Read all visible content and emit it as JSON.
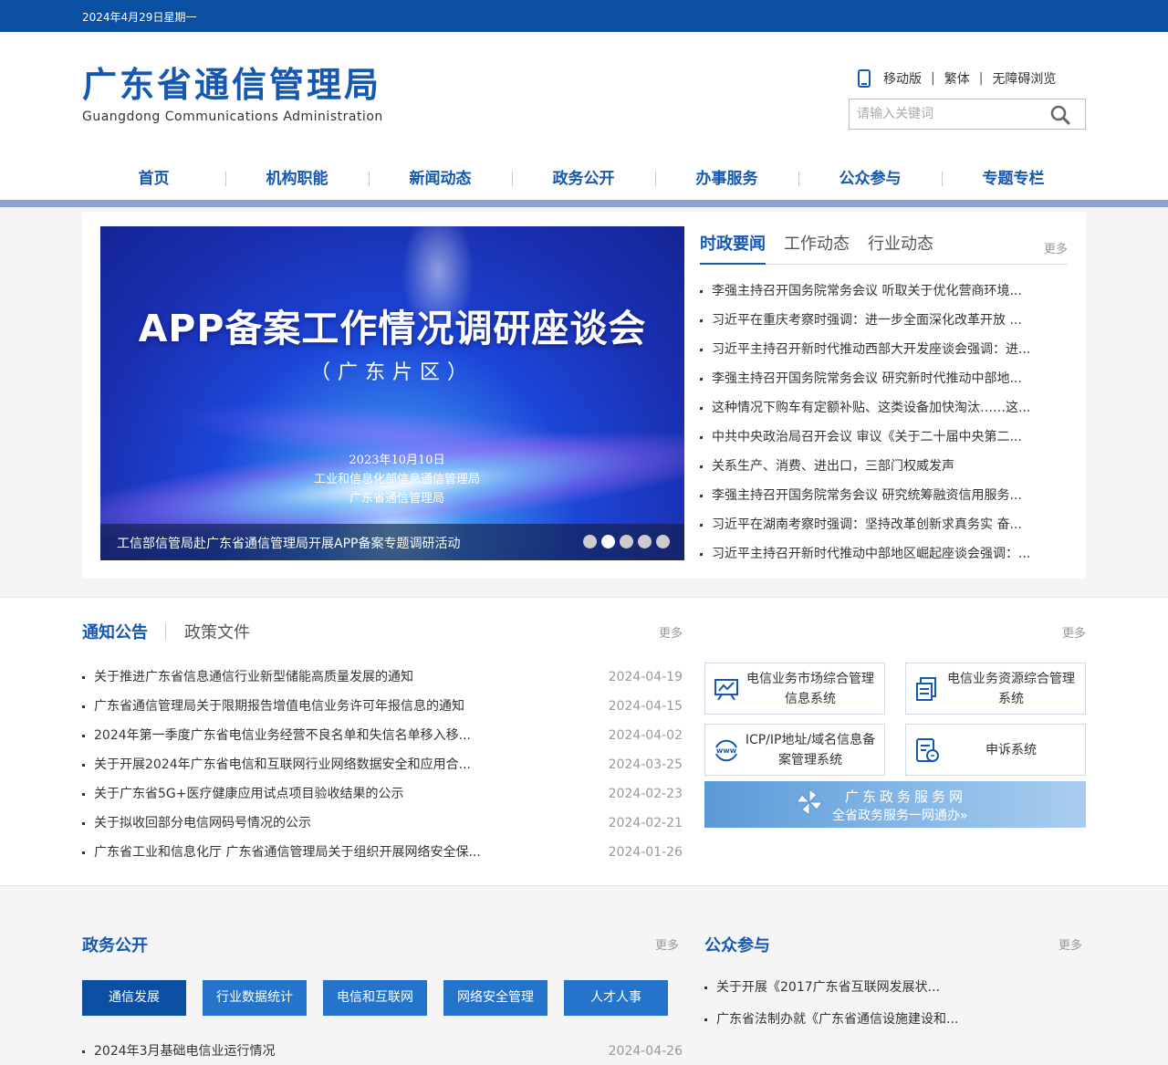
{
  "topbar": {
    "date": "2024年4月29日星期一"
  },
  "header": {
    "logo_cn": "广东省通信管理局",
    "logo_en": "Guangdong Communications Administration",
    "links": {
      "mobile": "移动版",
      "traditional": "繁体",
      "accessible": "无障碍浏览"
    },
    "search_placeholder": "请输入关键词"
  },
  "nav": [
    "首页",
    "机构职能",
    "新闻动态",
    "政务公开",
    "办事服务",
    "公众参与",
    "专题专栏"
  ],
  "banner": {
    "title": "APP备案工作情况调研座谈会",
    "subtitle": "（广东片区）",
    "date_line": "2023年10月10日",
    "org1": "工业和信息化部信息通信管理局",
    "org2": "广东省通信管理局",
    "caption": "工信部信管局赴广东省通信管理局开展APP备案专题调研活动",
    "slide_count": 5,
    "active_slide": 2
  },
  "news": {
    "tabs": [
      "时政要闻",
      "工作动态",
      "行业动态"
    ],
    "more": "更多",
    "items": [
      "李强主持召开国务院常务会议 听取关于优化营商环境...",
      "习近平在重庆考察时强调：进一步全面深化改革开放 ...",
      "习近平主持召开新时代推动西部大开发座谈会强调：进...",
      "李强主持召开国务院常务会议 研究新时代推动中部地...",
      "这种情况下购车有定额补贴、这类设备加快淘汰……这...",
      "中共中央政治局召开会议 审议《关于二十届中央第二...",
      "关系生产、消费、进出口，三部门权威发声",
      "李强主持召开国务院常务会议 研究统筹融资信用服务...",
      "习近平在湖南考察时强调：坚持改革创新求真务实 奋...",
      "习近平主持召开新时代推动中部地区崛起座谈会强调：..."
    ]
  },
  "notice": {
    "tab_active": "通知公告",
    "tab_other": "政策文件",
    "more": "更多",
    "items": [
      {
        "title": "关于推进广东省信息通信行业新型储能高质量发展的通知",
        "date": "2024-04-19"
      },
      {
        "title": "广东省通信管理局关于限期报告增值电信业务许可年报信息的通知",
        "date": "2024-04-15"
      },
      {
        "title": "2024年第一季度广东省电信业务经营不良名单和失信名单移入移...",
        "date": "2024-04-02"
      },
      {
        "title": "关于开展2024年广东省电信和互联网行业网络数据安全和应用合...",
        "date": "2024-03-25"
      },
      {
        "title": "关于广东省5G+医疗健康应用试点项目验收结果的公示",
        "date": "2024-02-23"
      },
      {
        "title": "关于拟收回部分电信网码号情况的公示",
        "date": "2024-02-21"
      },
      {
        "title": "广东省工业和信息化厅 广东省通信管理局关于组织开展网络安全保...",
        "date": "2024-01-26"
      }
    ]
  },
  "systems": {
    "more": "更多",
    "cards": [
      {
        "label": "电信业务市场综合管理信息系统",
        "icon": "chart-board-icon"
      },
      {
        "label": "电信业务资源综合管理系统",
        "icon": "document-stack-icon"
      },
      {
        "label": "ICP/IP地址/域名信息备案管理系统",
        "icon": "www-globe-icon"
      },
      {
        "label": "申诉系统",
        "icon": "complaint-form-icon"
      }
    ],
    "gd_banner": {
      "line1": "广东政务服务网",
      "line2": "全省政务服务一网通办»"
    }
  },
  "gov": {
    "title": "政务公开",
    "more": "更多",
    "buttons": [
      "通信发展",
      "行业数据统计",
      "电信和互联网",
      "网络安全管理",
      "人才人事"
    ],
    "item": {
      "title": "2024年3月基础电信业运行情况",
      "date": "2024-04-26"
    }
  },
  "public": {
    "title": "公众参与",
    "more": "更多",
    "items": [
      "关于开展《2017广东省互联网发展状...",
      "广东省法制办就《广东省通信设施建设和..."
    ]
  },
  "colors": {
    "brand": "#1558b0",
    "topbar": "#0b4fa3",
    "button": "#2474cc"
  }
}
